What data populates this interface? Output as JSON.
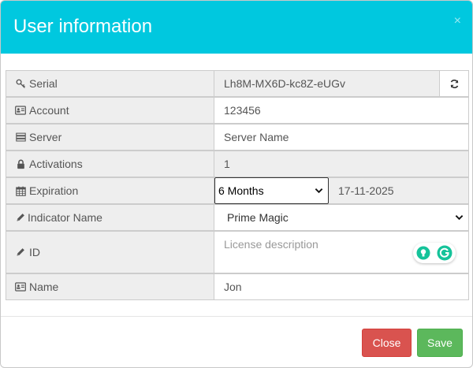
{
  "modal": {
    "title": "User information",
    "close_icon": "×"
  },
  "fields": {
    "serial": {
      "label": "Serial",
      "icon": "key-icon",
      "value": "Lh8M-MX6D-kc8Z-eUGv"
    },
    "account": {
      "label": "Account",
      "icon": "id-card-icon",
      "value": "123456"
    },
    "server": {
      "label": "Server",
      "icon": "server-icon",
      "value": "Server Name"
    },
    "activations": {
      "label": "Activations",
      "icon": "lock-icon",
      "value": "1"
    },
    "expiration": {
      "label": "Expiration",
      "icon": "calendar-icon",
      "selected": "6 Months",
      "date": "17-11-2025"
    },
    "indicator": {
      "label": "Indicator Name",
      "icon": "pencil-icon",
      "selected": "Prime Magic"
    },
    "id": {
      "label": "ID",
      "icon": "pencil-icon",
      "placeholder": "License description"
    },
    "name": {
      "label": "Name",
      "icon": "id-card-icon",
      "value": "Jon"
    }
  },
  "buttons": {
    "close": "Close",
    "save": "Save"
  },
  "colors": {
    "header": "#00c8df",
    "close_button": "#d9534f",
    "save_button": "#5cb85c"
  }
}
